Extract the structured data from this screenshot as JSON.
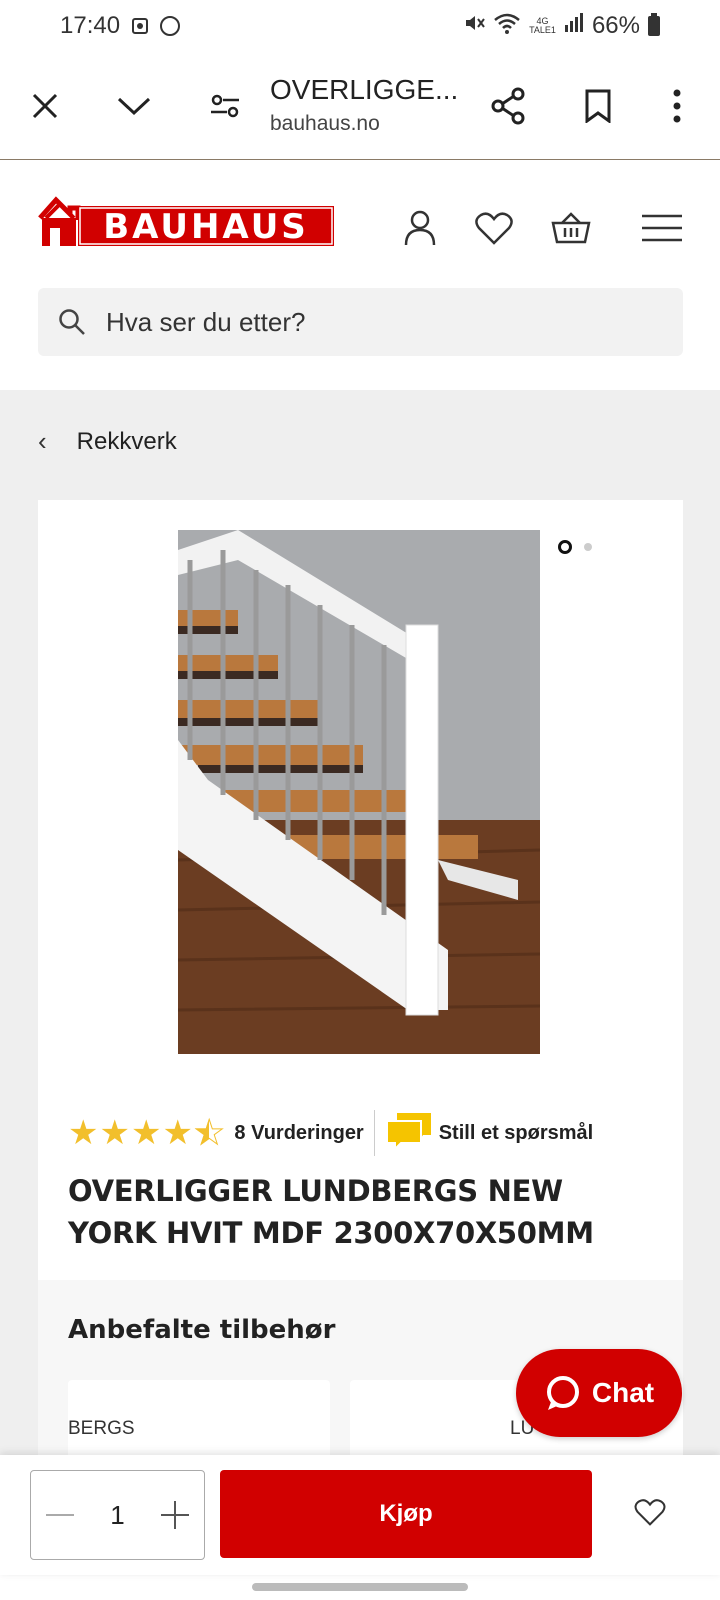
{
  "status_bar": {
    "time": "17:40",
    "network": "4G",
    "network_sub": "TALE1",
    "battery": "66%"
  },
  "browser": {
    "page_title": "OVERLIGGE...",
    "domain": "bauhaus.no"
  },
  "header": {
    "logo_text": "BAUHAUS",
    "search_placeholder": "Hva ser du etter?"
  },
  "breadcrumb": {
    "label": "Rekkverk"
  },
  "product": {
    "rating": 4.5,
    "rating_max": 5,
    "reviews_label": "8 Vurderinger",
    "ask_label": "Still et spørsmål",
    "title": "OVERLIGGER LUNDBERGS NEW YORK HVIT MDF 2300X70X50MM",
    "image_count": 2,
    "active_image": 1
  },
  "accessories": {
    "title": "Anbefalte tilbehør",
    "items": [
      {
        "label": "BERGS"
      },
      {
        "label": "LU"
      }
    ]
  },
  "chat": {
    "label": "Chat"
  },
  "buy_bar": {
    "quantity": "1",
    "buy_label": "Kjøp"
  },
  "colors": {
    "brand_red": "#d10000",
    "star_yellow": "#f2bf2c",
    "chat_bubble_yellow": "#f5c400"
  }
}
